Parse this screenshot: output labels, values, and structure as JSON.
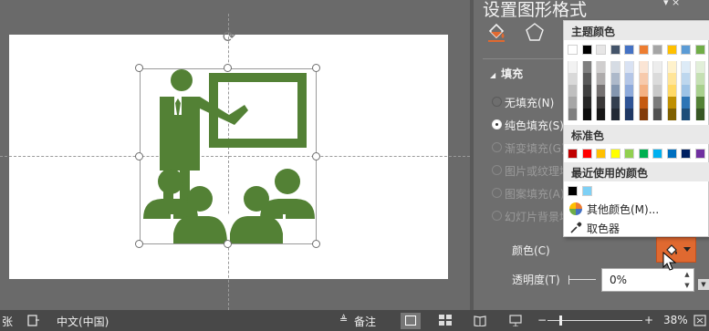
{
  "panel": {
    "title": "设置图形格式",
    "close": "▾ ×"
  },
  "tabs": {
    "fill_icon": "fill-effects-icon",
    "shape_icon": "pentagon-icon"
  },
  "fill": {
    "header": "填充",
    "options": [
      {
        "label": "无填充(N)",
        "selected": false,
        "enabled": true
      },
      {
        "label": "纯色填充(S)",
        "selected": true,
        "enabled": true
      },
      {
        "label": "渐变填充(G)",
        "selected": false,
        "enabled": false
      },
      {
        "label": "图片或纹理填充(P)",
        "selected": false,
        "enabled": false
      },
      {
        "label": "图案填充(A)",
        "selected": false,
        "enabled": false
      },
      {
        "label": "幻灯片背景填充(B)",
        "selected": false,
        "enabled": false
      }
    ],
    "color_label": "颜色(C)",
    "transparency_label": "透明度(T)",
    "transparency_value": "0%"
  },
  "color_menu": {
    "theme_header": "主题颜色",
    "theme_row": [
      "#ffffff",
      "#000000",
      "#e7e6e6",
      "#44546a",
      "#4472c4",
      "#ed7d31",
      "#a5a5a5",
      "#ffc000",
      "#5b9bd5",
      "#70ad47"
    ],
    "theme_shades": [
      [
        "#f2f2f2",
        "#d9d9d9",
        "#bfbfbf",
        "#a6a6a6",
        "#808080"
      ],
      [
        "#7f7f7f",
        "#595959",
        "#404040",
        "#262626",
        "#0d0d0d"
      ],
      [
        "#d0cece",
        "#aeabab",
        "#757171",
        "#3a3838",
        "#171616"
      ],
      [
        "#d6dce4",
        "#adb9ca",
        "#8497b0",
        "#333f4f",
        "#222a35"
      ],
      [
        "#d9e2f3",
        "#b4c6e7",
        "#8eaadb",
        "#2f5496",
        "#1f3864"
      ],
      [
        "#fbe5d5",
        "#f7caac",
        "#f4b183",
        "#c55a11",
        "#833c0b"
      ],
      [
        "#ededed",
        "#dbdbdb",
        "#c9c9c9",
        "#7b7b7b",
        "#525252"
      ],
      [
        "#fff2cc",
        "#ffe599",
        "#ffd966",
        "#bf8f00",
        "#7f6000"
      ],
      [
        "#ddebf7",
        "#bdd7ee",
        "#9dc3e6",
        "#2e75b5",
        "#1e4e79"
      ],
      [
        "#e2efd9",
        "#c5e0b3",
        "#a8d08d",
        "#538135",
        "#375623"
      ]
    ],
    "standard_header": "标准色",
    "standard": [
      "#c00000",
      "#ff0000",
      "#ffc000",
      "#ffff00",
      "#92d050",
      "#00b050",
      "#00b0f0",
      "#0070c0",
      "#002060",
      "#7030a0"
    ],
    "recent_header": "最近使用的颜色",
    "recent": [
      "#000000",
      "#7ed0f5"
    ],
    "more_colors": "其他颜色(M)...",
    "eyedropper": "取色器"
  },
  "status": {
    "slide_label": "张",
    "language": "中文(中国)",
    "notes": "备注",
    "zoom": "38%",
    "zoom_minus": "−",
    "zoom_plus": "+"
  },
  "colors": {
    "accent": "#e06930",
    "icon_green": "#538135"
  }
}
